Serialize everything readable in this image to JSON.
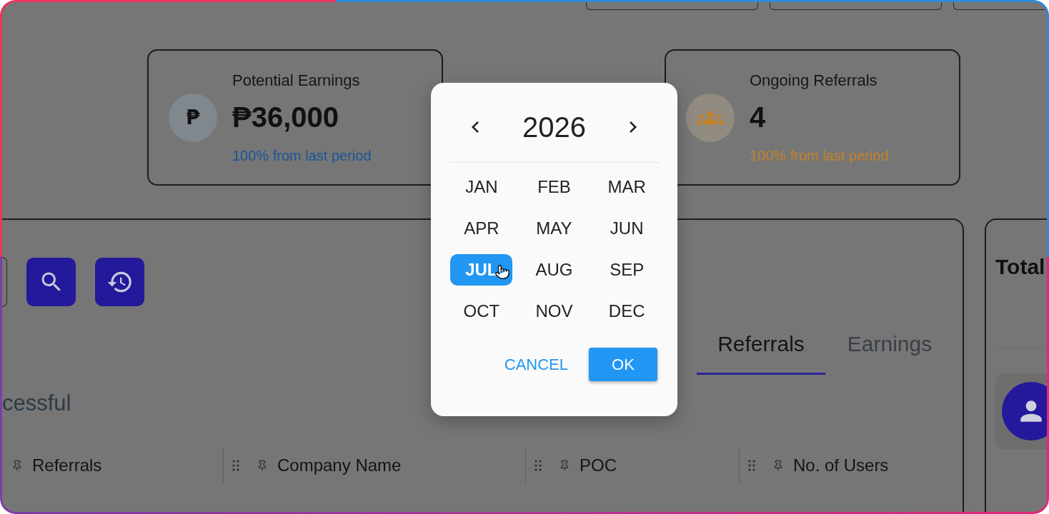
{
  "stats": [
    {
      "title": "Potential Earnings",
      "value": "₱36,000",
      "change": "100% from last period",
      "color": "#17579a",
      "icon": {
        "kind": "glyph",
        "glyph": "₱"
      }
    },
    {
      "title": "Ongoing Referrals",
      "value": "4",
      "change": "100% from last period",
      "color": "#c4832a",
      "icon": {
        "kind": "people"
      }
    }
  ],
  "referrals_panel": {
    "tabs": [
      {
        "label": "Referrals",
        "selected": true
      },
      {
        "label": "Earnings",
        "selected": false
      }
    ],
    "heading": "cessful",
    "columns": [
      {
        "label": "Referrals"
      },
      {
        "label": "Company Name"
      },
      {
        "label": "POC"
      },
      {
        "label": "No. of Users"
      }
    ]
  },
  "side_panel": {
    "title": "Total"
  },
  "month_picker": {
    "year": "2026",
    "months": [
      {
        "label": "JAN",
        "selected": false
      },
      {
        "label": "FEB",
        "selected": false
      },
      {
        "label": "MAR",
        "selected": false
      },
      {
        "label": "APR",
        "selected": false
      },
      {
        "label": "MAY",
        "selected": false
      },
      {
        "label": "JUN",
        "selected": false
      },
      {
        "label": "JUL",
        "selected": true
      },
      {
        "label": "AUG",
        "selected": false
      },
      {
        "label": "SEP",
        "selected": false
      },
      {
        "label": "OCT",
        "selected": false
      },
      {
        "label": "NOV",
        "selected": false
      },
      {
        "label": "DEC",
        "selected": false
      }
    ],
    "actions": [
      {
        "label": "CANCEL",
        "kind": "text"
      },
      {
        "label": "OK",
        "kind": "contained"
      }
    ]
  }
}
